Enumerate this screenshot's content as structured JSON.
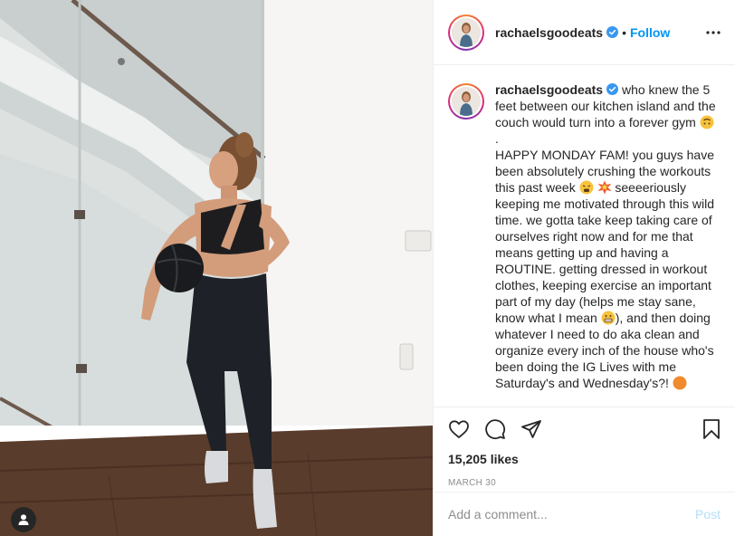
{
  "post": {
    "username": "rachaelsgoodeats",
    "follow_label": "Follow",
    "separator": "•",
    "caption": {
      "line1": "who knew the 5 feet between our kitchen island and the couch would turn into a forever gym",
      "line2": ".",
      "line3a": "HAPPY MONDAY FAM! you guys have been absolutely crushing the workouts this past week",
      "line3b": "seeeeriously keeping me motivated through this wild time. we gotta take keep taking care of ourselves right now and for me that means getting up and having a ROUTINE. getting dressed in workout clothes, keeping exercise an important part of my day (helps me stay sane, know what I mean",
      "line3c": "), and then doing whatever I need to do aka clean and organize every inch of the house who's been doing the IG Lives with me Saturday's and Wednesday's?!"
    },
    "likes": "15,205 likes",
    "date": "MARCH 30",
    "comment_placeholder": "Add a comment...",
    "post_label": "Post"
  },
  "icons": {
    "verified": "verified-badge-icon",
    "more": "more-options-icon",
    "like": "heart-icon",
    "comment": "comment-icon",
    "share": "paper-plane-icon",
    "save": "bookmark-icon",
    "user_tag": "user-tag-icon"
  },
  "colors": {
    "follow": "#0095f6",
    "verified": "#3897f0",
    "post_disabled": "#b2dffc",
    "secondary_text": "#8e8e8e"
  }
}
